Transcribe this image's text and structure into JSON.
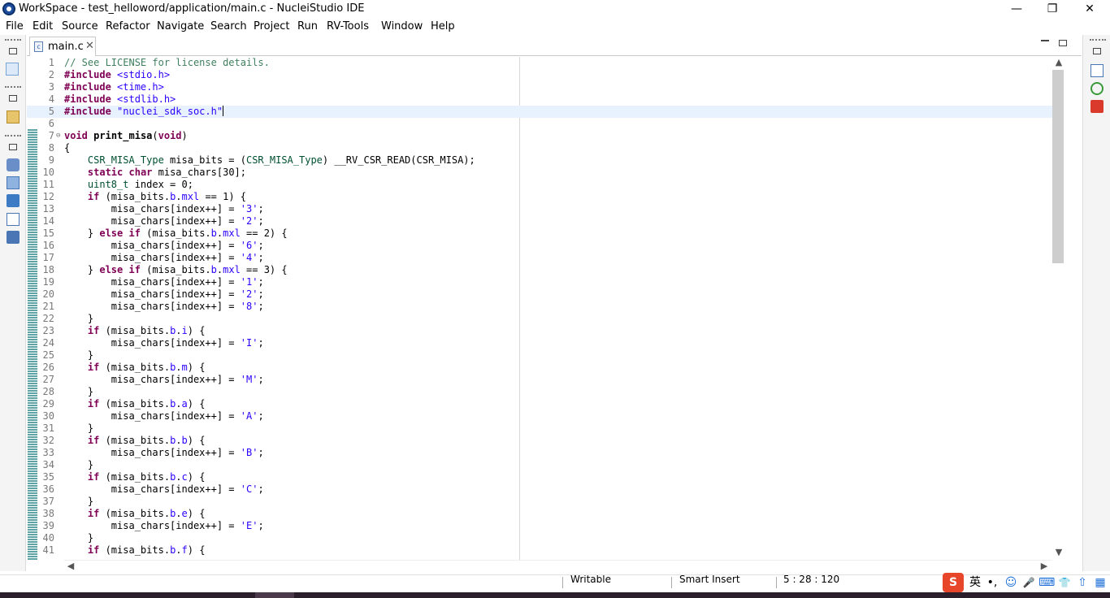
{
  "window": {
    "title": "WorkSpace - test_helloword/application/main.c - NucleiStudio IDE",
    "minimize": "—",
    "restore": "❐",
    "close": "✕"
  },
  "menu": [
    "File",
    "Edit",
    "Source",
    "Refactor",
    "Navigate",
    "Search",
    "Project",
    "Run",
    "RV-Tools",
    "Window",
    "Help"
  ],
  "editor": {
    "tab_label": "main.c",
    "tab_icon_letter": "c",
    "tab_close": "✕",
    "lines": [
      {
        "n": "1",
        "html": "<span class='c-com'>// See LICENSE for license details.</span>"
      },
      {
        "n": "2",
        "html": "<span class='c-kw'>#include</span> <span class='c-str'>&lt;stdio.h&gt;</span>"
      },
      {
        "n": "3",
        "html": "<span class='c-kw'>#include</span> <span class='c-str'>&lt;time.h&gt;</span>"
      },
      {
        "n": "4",
        "html": "<span class='c-kw'>#include</span> <span class='c-str'>&lt;stdlib.h&gt;</span>"
      },
      {
        "n": "5",
        "html": "<span class='c-kw'>#include</span> <span class='c-str'>\"nuclei_sdk_soc.h\"</span><span class='caret'></span>",
        "current": true
      },
      {
        "n": "6",
        "html": ""
      },
      {
        "n": "7",
        "html": "<span class='c-kw'>void</span> <b>print_misa</b>(<span class='c-kw'>void</span>)",
        "fold": "⊖"
      },
      {
        "n": "8",
        "html": "{"
      },
      {
        "n": "9",
        "html": "    <span class='c-type'>CSR_MISA_Type</span> misa_bits = (<span class='c-type'>CSR_MISA_Type</span>) __RV_CSR_READ(CSR_MISA);"
      },
      {
        "n": "10",
        "html": "    <span class='c-kw'>static</span> <span class='c-kw'>char</span> misa_chars[30];"
      },
      {
        "n": "11",
        "html": "    <span class='c-type'>uint8_t</span> index = 0;"
      },
      {
        "n": "12",
        "html": "    <span class='c-kw'>if</span> (misa_bits.<span class='c-str'>b</span>.<span class='c-str'>mxl</span> == 1) {"
      },
      {
        "n": "13",
        "html": "        misa_chars[index++] = <span class='c-str'>'3'</span>;"
      },
      {
        "n": "14",
        "html": "        misa_chars[index++] = <span class='c-str'>'2'</span>;"
      },
      {
        "n": "15",
        "html": "    } <span class='c-kw'>else</span> <span class='c-kw'>if</span> (misa_bits.<span class='c-str'>b</span>.<span class='c-str'>mxl</span> == 2) {"
      },
      {
        "n": "16",
        "html": "        misa_chars[index++] = <span class='c-str'>'6'</span>;"
      },
      {
        "n": "17",
        "html": "        misa_chars[index++] = <span class='c-str'>'4'</span>;"
      },
      {
        "n": "18",
        "html": "    } <span class='c-kw'>else</span> <span class='c-kw'>if</span> (misa_bits.<span class='c-str'>b</span>.<span class='c-str'>mxl</span> == 3) {"
      },
      {
        "n": "19",
        "html": "        misa_chars[index++] = <span class='c-str'>'1'</span>;"
      },
      {
        "n": "20",
        "html": "        misa_chars[index++] = <span class='c-str'>'2'</span>;"
      },
      {
        "n": "21",
        "html": "        misa_chars[index++] = <span class='c-str'>'8'</span>;"
      },
      {
        "n": "22",
        "html": "    }"
      },
      {
        "n": "23",
        "html": "    <span class='c-kw'>if</span> (misa_bits.<span class='c-str'>b</span>.<span class='c-str'>i</span>) {"
      },
      {
        "n": "24",
        "html": "        misa_chars[index++] = <span class='c-str'>'I'</span>;"
      },
      {
        "n": "25",
        "html": "    }"
      },
      {
        "n": "26",
        "html": "    <span class='c-kw'>if</span> (misa_bits.<span class='c-str'>b</span>.<span class='c-str'>m</span>) {"
      },
      {
        "n": "27",
        "html": "        misa_chars[index++] = <span class='c-str'>'M'</span>;"
      },
      {
        "n": "28",
        "html": "    }"
      },
      {
        "n": "29",
        "html": "    <span class='c-kw'>if</span> (misa_bits.<span class='c-str'>b</span>.<span class='c-str'>a</span>) {"
      },
      {
        "n": "30",
        "html": "        misa_chars[index++] = <span class='c-str'>'A'</span>;"
      },
      {
        "n": "31",
        "html": "    }"
      },
      {
        "n": "32",
        "html": "    <span class='c-kw'>if</span> (misa_bits.<span class='c-str'>b</span>.<span class='c-str'>b</span>) {"
      },
      {
        "n": "33",
        "html": "        misa_chars[index++] = <span class='c-str'>'B'</span>;"
      },
      {
        "n": "34",
        "html": "    }"
      },
      {
        "n": "35",
        "html": "    <span class='c-kw'>if</span> (misa_bits.<span class='c-str'>b</span>.<span class='c-str'>c</span>) {"
      },
      {
        "n": "36",
        "html": "        misa_chars[index++] = <span class='c-str'>'C'</span>;"
      },
      {
        "n": "37",
        "html": "    }"
      },
      {
        "n": "38",
        "html": "    <span class='c-kw'>if</span> (misa_bits.<span class='c-str'>b</span>.<span class='c-str'>e</span>) {"
      },
      {
        "n": "39",
        "html": "        misa_chars[index++] = <span class='c-str'>'E'</span>;"
      },
      {
        "n": "40",
        "html": "    }"
      },
      {
        "n": "41",
        "html": "    <span class='c-kw'>if</span> (misa_bits.<span class='c-str'>b</span>.<span class='c-str'>f</span>) {"
      }
    ]
  },
  "status": {
    "writable": "Writable",
    "insert_mode": "Smart Insert",
    "position": "5 : 28 : 120"
  },
  "ime": {
    "sogou": "S",
    "lang": "英",
    "punct": "•,",
    "emoji": "☺",
    "mic": "🎤",
    "keyboard": "⌨",
    "skin": "👕",
    "arrow": "⇧",
    "grid": "▦"
  },
  "colors": {
    "keyword": "#7f0055",
    "comment": "#3f7f5f",
    "string": "#2a00ff",
    "current_line": "#e8f2fe",
    "change_bar": "#5fa4a4"
  }
}
